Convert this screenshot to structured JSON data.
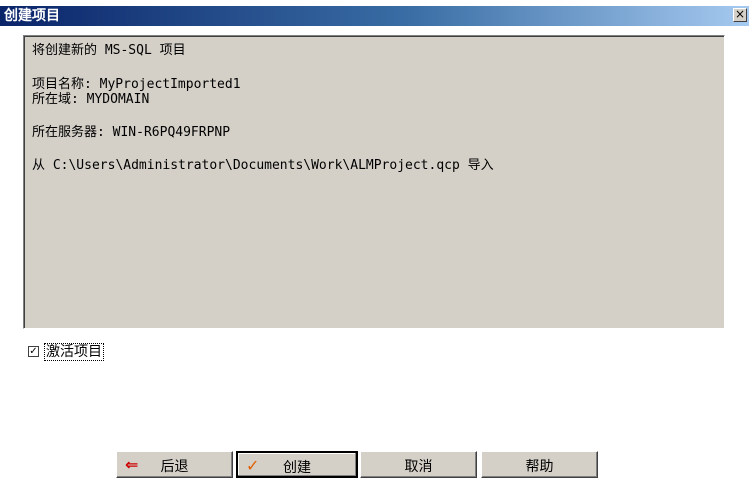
{
  "window": {
    "title": "创建项目",
    "close_glyph": "×"
  },
  "info": {
    "line1": "将创建新的 MS-SQL 项目",
    "project_name": "项目名称: MyProjectImported1",
    "domain": "所在域: MYDOMAIN",
    "server": "所在服务器: WIN-R6PQ49FRPNP",
    "source": "从 C:\\Users\\Administrator\\Documents\\Work\\ALMProject.qcp 导入"
  },
  "activate": {
    "label": "激活项目",
    "checked": true,
    "check_glyph": "✓"
  },
  "buttons": {
    "back": {
      "label": "后退",
      "icon": "arrow-left-icon",
      "glyph": "⇐"
    },
    "create": {
      "label": "创建",
      "icon": "checkmark-icon",
      "glyph": "✓"
    },
    "cancel": {
      "label": "取消"
    },
    "help": {
      "label": "帮助"
    }
  },
  "colors": {
    "back_icon": "#cc0000",
    "create_icon": "#e06000"
  }
}
